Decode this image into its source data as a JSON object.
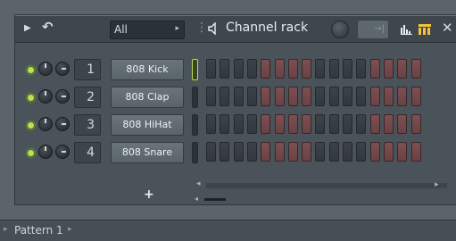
{
  "window": {
    "title": "Channel rack",
    "filter": "All",
    "filter_arrow": "▸",
    "rack_display": "→|"
  },
  "colors": {
    "active_step": "#7d4f52",
    "inactive_step": "#3c4348",
    "led_on": "#b7e25a"
  },
  "icons": [
    "play-icon",
    "undo-icon",
    "grip-icon",
    "speaker-icon",
    "graph-icon",
    "step-sequencer-icon",
    "close-icon",
    "add-icon"
  ],
  "channels": [
    {
      "number": "1",
      "name": "808 Kick",
      "selected": true
    },
    {
      "number": "2",
      "name": "808 Clap",
      "selected": false
    },
    {
      "number": "3",
      "name": "808 HiHat",
      "selected": false
    },
    {
      "number": "4",
      "name": "808 Snare",
      "selected": false
    }
  ],
  "step_colors": [
    "g",
    "g",
    "g",
    "g",
    "r",
    "r",
    "r",
    "r",
    "g",
    "g",
    "g",
    "g",
    "r",
    "r",
    "r",
    "r"
  ],
  "add_label": "+",
  "bottom": {
    "pattern": "Pattern 1"
  }
}
